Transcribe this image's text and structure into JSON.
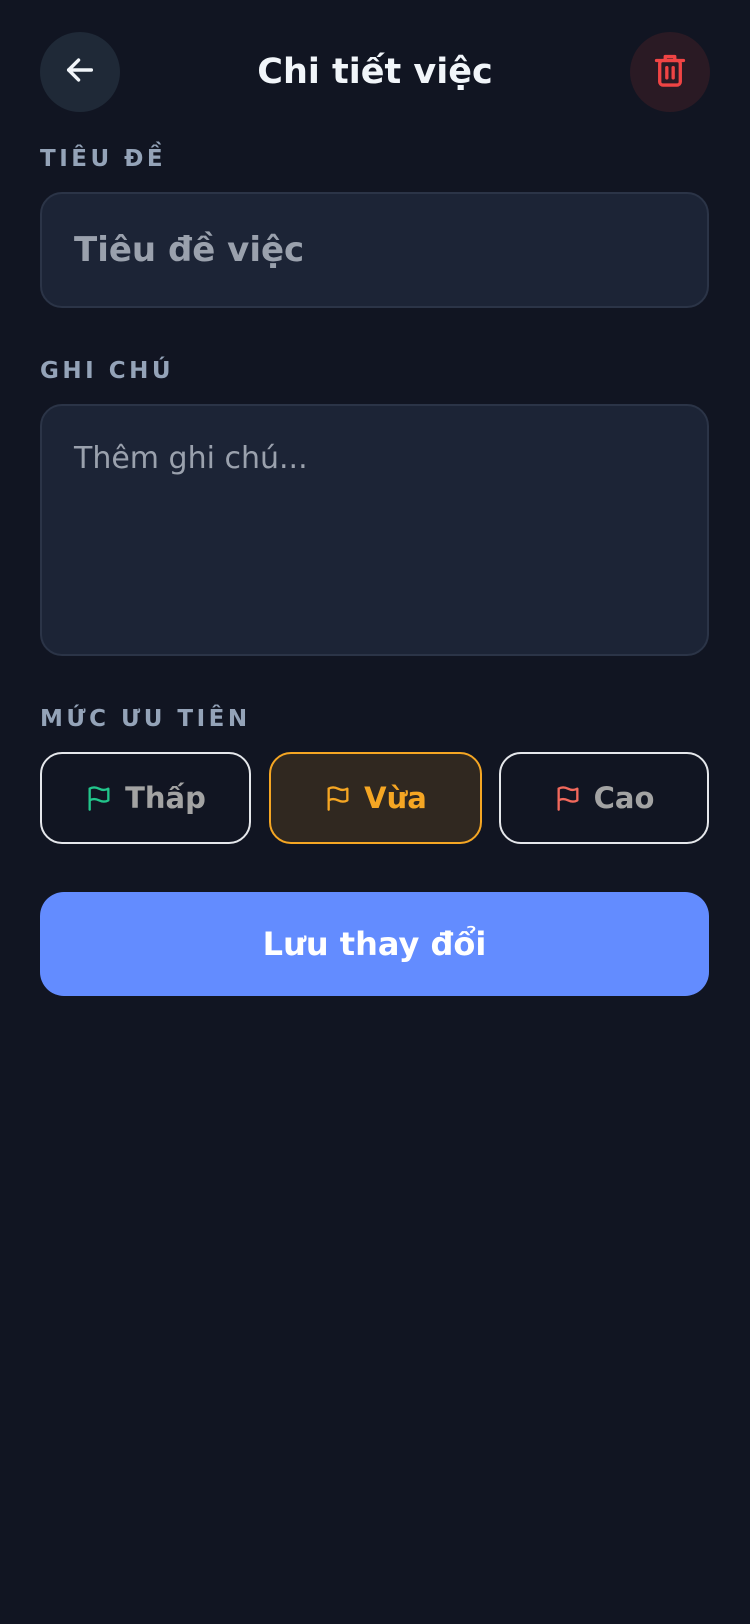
{
  "header": {
    "title": "Chi tiết việc",
    "back_icon": "arrow-left-icon",
    "delete_icon": "trash-icon"
  },
  "form": {
    "title_label": "TIÊU ĐỀ",
    "title_value": "",
    "title_placeholder": "Tiêu đề việc",
    "notes_label": "GHI CHÚ",
    "notes_value": "",
    "notes_placeholder": "Thêm ghi chú..."
  },
  "priority": {
    "label": "MỨC ƯU TIÊN",
    "selected": "Vừa",
    "options": [
      {
        "label": "Thấp",
        "icon": "flag-icon",
        "color": "#22c58b"
      },
      {
        "label": "Vừa",
        "icon": "flag-icon",
        "color": "#f5a623"
      },
      {
        "label": "Cao",
        "icon": "flag-icon",
        "color": "#f2695c"
      }
    ]
  },
  "actions": {
    "save_label": "Lưu thay đổi"
  },
  "colors": {
    "background": "#111522",
    "surface": "#1c2436",
    "accent": "#638cff",
    "danger": "#ef4444",
    "muted_text": "#94a3b8"
  }
}
